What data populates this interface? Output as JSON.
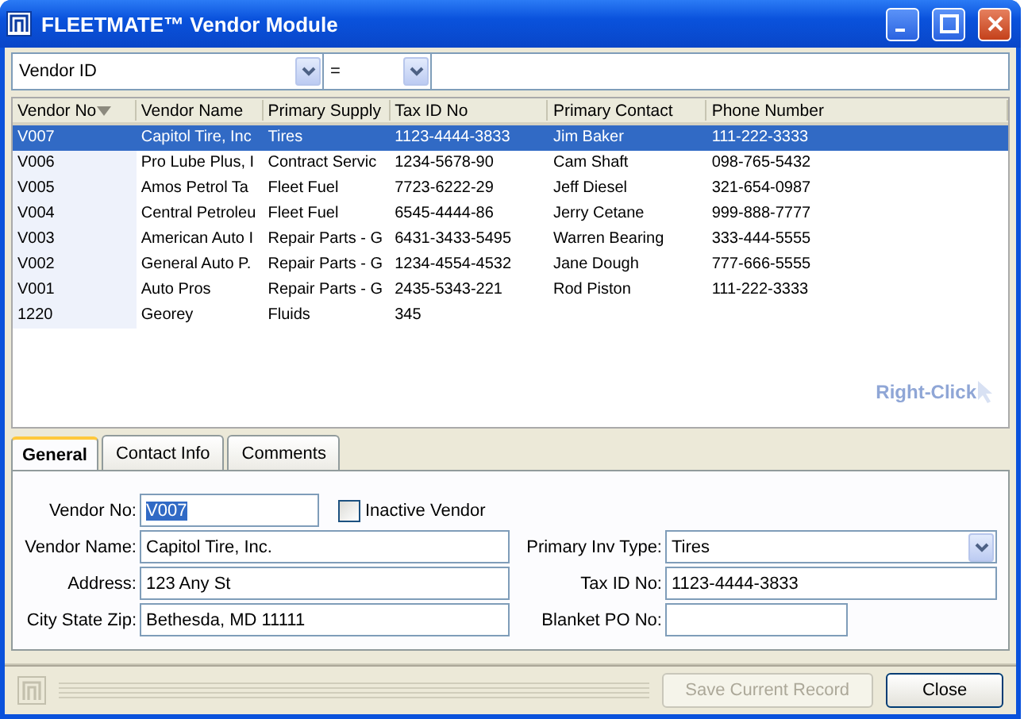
{
  "window": {
    "title": "FLEETMATE™ Vendor Module"
  },
  "filter": {
    "field": "Vendor ID",
    "operator": "="
  },
  "table": {
    "columns": [
      {
        "label": "Vendor No",
        "sorted": true
      },
      {
        "label": "Vendor Name",
        "sorted": false
      },
      {
        "label": "Primary Supply",
        "sorted": false
      },
      {
        "label": "Tax ID No",
        "sorted": false
      },
      {
        "label": "Primary Contact",
        "sorted": false
      },
      {
        "label": "Phone Number",
        "sorted": false
      }
    ],
    "rows": [
      {
        "selected": true,
        "cells": [
          "V007",
          "Capitol Tire, Inc",
          "Tires",
          "1123-4444-3833",
          "Jim Baker",
          "111-222-3333"
        ]
      },
      {
        "selected": false,
        "cells": [
          "V006",
          "Pro Lube Plus, I",
          "Contract Servic",
          "1234-5678-90",
          "Cam Shaft",
          "098-765-5432"
        ]
      },
      {
        "selected": false,
        "cells": [
          "V005",
          "Amos Petrol Ta",
          "Fleet Fuel",
          "7723-6222-29",
          "Jeff Diesel",
          "321-654-0987"
        ]
      },
      {
        "selected": false,
        "cells": [
          "V004",
          "Central Petroleu",
          "Fleet Fuel",
          "6545-4444-86",
          "Jerry Cetane",
          "999-888-7777"
        ]
      },
      {
        "selected": false,
        "cells": [
          "V003",
          "American Auto I",
          "Repair Parts - G",
          "6431-3433-5495",
          "Warren Bearing",
          "333-444-5555"
        ]
      },
      {
        "selected": false,
        "cells": [
          "V002",
          "General Auto P.",
          "Repair Parts - G",
          "1234-4554-4532",
          "Jane Dough",
          "777-666-5555"
        ]
      },
      {
        "selected": false,
        "cells": [
          "V001",
          "Auto Pros",
          "Repair Parts - G",
          "2435-5343-221",
          "Rod Piston",
          "111-222-3333"
        ]
      },
      {
        "selected": false,
        "cells": [
          "1220",
          "Georey",
          "Fluids",
          "345",
          "",
          ""
        ]
      }
    ],
    "hint": "Right-Click"
  },
  "tabs": [
    {
      "label": "General",
      "selected": true
    },
    {
      "label": "Contact Info",
      "selected": false
    },
    {
      "label": "Comments",
      "selected": false
    }
  ],
  "form": {
    "left": [
      {
        "label": "Vendor No:",
        "value": "V007",
        "kind": "short"
      },
      {
        "label": "Vendor Name:",
        "value": "Capitol Tire, Inc.",
        "kind": "text"
      },
      {
        "label": "Address:",
        "value": "123 Any St",
        "kind": "text"
      },
      {
        "label": "City State Zip:",
        "value": "Bethesda, MD 11111",
        "kind": "text"
      }
    ],
    "inactive": {
      "label": "Inactive Vendor",
      "checked": false
    },
    "right": [
      {
        "label": "Primary Inv Type:",
        "value": "Tires",
        "kind": "select"
      },
      {
        "label": "Tax ID No:",
        "value": "1123-4444-3833",
        "kind": "text"
      },
      {
        "label": "Blanket PO No:",
        "kind": "short"
      }
    ]
  },
  "buttons": [
    {
      "label": "Save Current Record",
      "disabled": true
    },
    {
      "label": "Close",
      "disabled": false
    }
  ]
}
